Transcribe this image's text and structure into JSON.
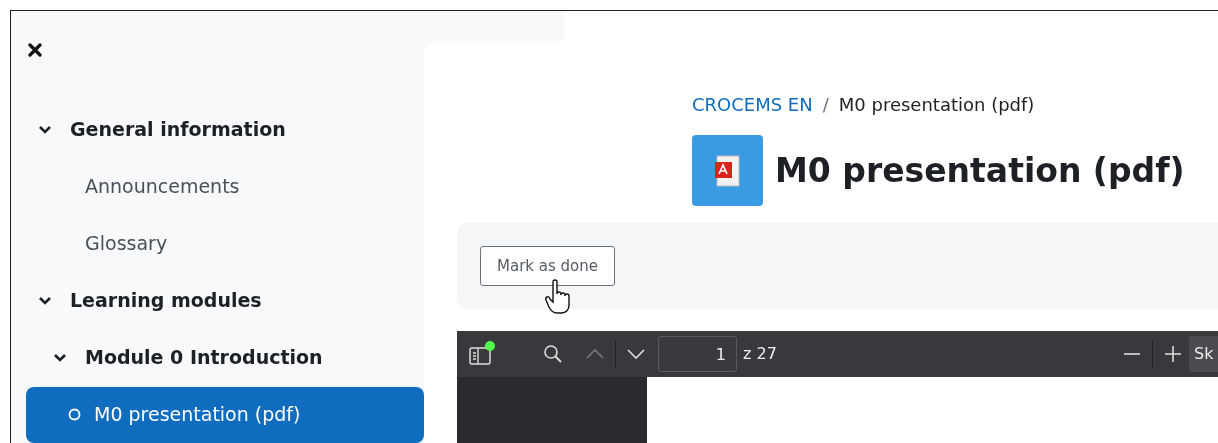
{
  "sidebar": {
    "items": [
      {
        "kind": "section",
        "label": "General information",
        "expanded": true,
        "children": [
          {
            "kind": "link",
            "label": "Announcements",
            "selected": false
          },
          {
            "kind": "link",
            "label": "Glossary",
            "selected": false
          }
        ]
      },
      {
        "kind": "section",
        "label": "Learning modules",
        "expanded": true,
        "children": [
          {
            "kind": "section",
            "label": "Module 0 Introduction",
            "expanded": true,
            "children": [
              {
                "kind": "activity",
                "label": "M0 presentation (pdf)",
                "selected": true
              }
            ]
          }
        ]
      }
    ]
  },
  "breadcrumb": [
    {
      "label": "CROCEMS EN",
      "kind": "link"
    },
    {
      "label": "/",
      "kind": "separator"
    },
    {
      "label": "M0 presentation (pdf)",
      "kind": "current"
    }
  ],
  "page_title": "M0 presentation (pdf)",
  "completion_button": "Mark as done",
  "pdf_viewer": {
    "page": "1",
    "page_count": "z 27",
    "button_cut": "Sk"
  }
}
